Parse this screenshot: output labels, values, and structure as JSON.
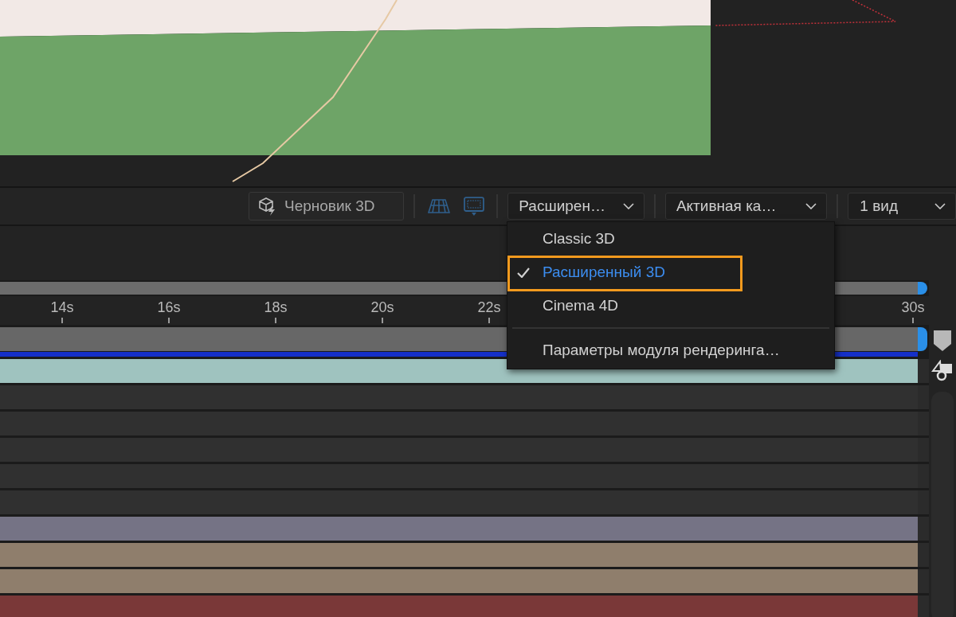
{
  "toolbar": {
    "draft_button": {
      "label": "Черновик 3D",
      "on": false
    },
    "renderer_dropdown": {
      "value": "Расширен…"
    },
    "camera_dropdown": {
      "value": "Активная ка…"
    },
    "views_dropdown": {
      "value": "1 вид"
    }
  },
  "renderer_menu": {
    "items": [
      {
        "kind": "option",
        "label": "Classic 3D",
        "selected": false,
        "highlighted": false
      },
      {
        "kind": "option",
        "label": "Расширенный 3D",
        "selected": true,
        "highlighted": true
      },
      {
        "kind": "option",
        "label": "Cinema 4D",
        "selected": false,
        "highlighted": false
      },
      {
        "kind": "separator"
      },
      {
        "kind": "command",
        "label": "Параметры модуля рендеринга…"
      }
    ]
  },
  "timeline": {
    "ticks": [
      "14s",
      "16s",
      "18s",
      "20s",
      "22s",
      "30s"
    ],
    "layers": [
      {
        "kind": "bar",
        "color": "#9fc3bf"
      },
      {
        "kind": "track"
      },
      {
        "kind": "track"
      },
      {
        "kind": "track"
      },
      {
        "kind": "track"
      },
      {
        "kind": "track"
      },
      {
        "kind": "bar",
        "color": "#757385"
      },
      {
        "kind": "bar",
        "color": "#8f7e6c"
      },
      {
        "kind": "bar",
        "color": "#8f7e6c"
      },
      {
        "kind": "bar",
        "color": "#7a3838"
      }
    ]
  }
}
